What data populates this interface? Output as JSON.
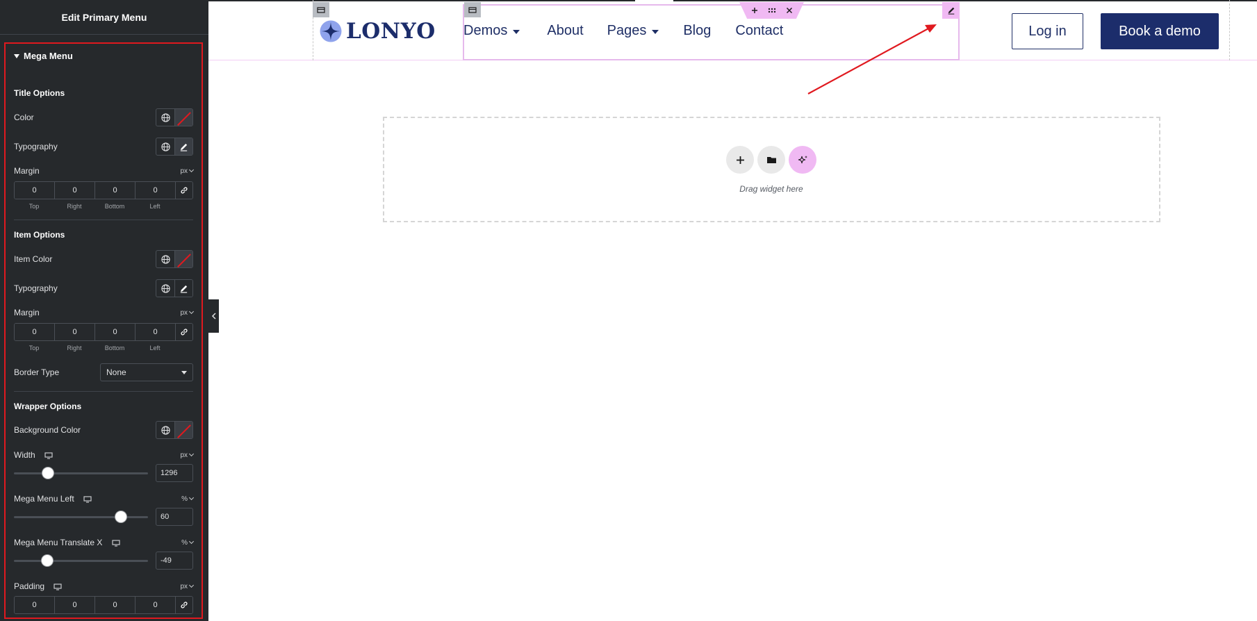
{
  "sidebar": {
    "title": "Edit Primary Menu",
    "section_title": "Mega Menu",
    "title_options": {
      "heading": "Title Options",
      "color_label": "Color",
      "typography_label": "Typography",
      "margin_label": "Margin",
      "margin_unit": "px",
      "margin_values": [
        "0",
        "0",
        "0",
        "0"
      ],
      "margin_sides": [
        "Top",
        "Right",
        "Bottom",
        "Left"
      ]
    },
    "item_options": {
      "heading": "Item Options",
      "color_label": "Item Color",
      "typography_label": "Typography",
      "margin_label": "Margin",
      "margin_unit": "px",
      "margin_values": [
        "0",
        "0",
        "0",
        "0"
      ],
      "margin_sides": [
        "Top",
        "Right",
        "Bottom",
        "Left"
      ],
      "border_type_label": "Border Type",
      "border_type_value": "None"
    },
    "wrapper_options": {
      "heading": "Wrapper Options",
      "bg_color_label": "Background Color",
      "width_label": "Width",
      "width_unit": "px",
      "width_value": "1296",
      "left_label": "Mega Menu Left",
      "left_unit": "%",
      "left_value": "60",
      "translate_label": "Mega Menu Translate X",
      "translate_unit": "%",
      "translate_value": "-49",
      "padding_label": "Padding",
      "padding_unit": "px",
      "padding_values": [
        "0",
        "0",
        "0",
        "0"
      ]
    }
  },
  "canvas": {
    "logo_text": "LONYO",
    "nav_items": [
      "Demos",
      "About",
      "Pages",
      "Blog",
      "Contact"
    ],
    "login_label": "Log in",
    "demo_label": "Book a demo",
    "drop_text": "Drag widget here"
  },
  "colors": {
    "sidebar_bg": "#26292c",
    "highlight_red": "#e0191f",
    "brand_navy": "#1c2d6b",
    "editor_pink": "#f0b9f3"
  },
  "icons": [
    "globe-icon",
    "pencil-icon",
    "link-icon",
    "desktop-icon",
    "plus-icon",
    "folder-icon",
    "sparkle-icon",
    "drag-grid-icon",
    "close-icon",
    "arrow-annotation"
  ]
}
